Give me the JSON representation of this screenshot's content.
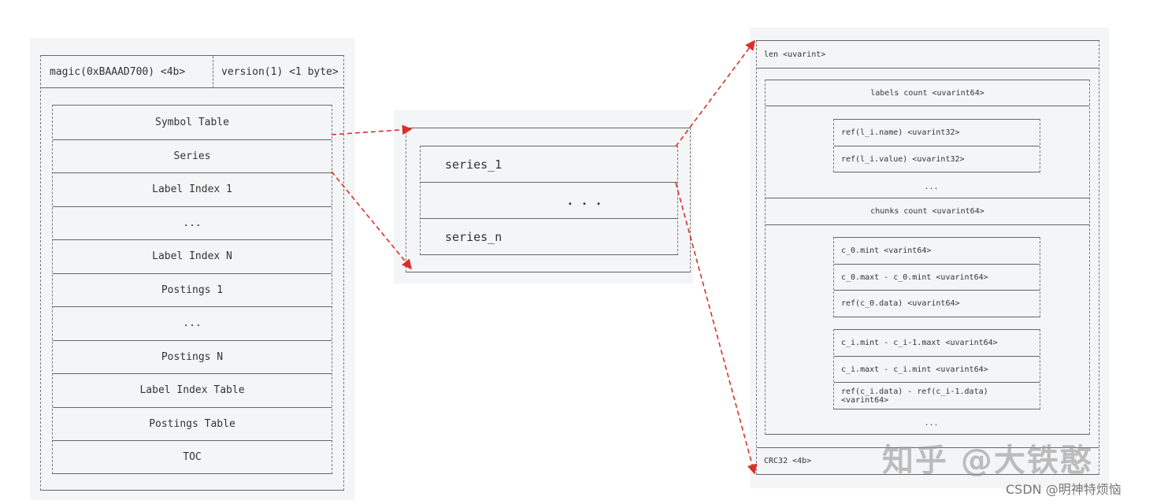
{
  "index_format": {
    "magic": "magic(0xBAAAD700) <4b>",
    "version": "version(1) <1 byte>",
    "sections": [
      "Symbol Table",
      "Series",
      "Label Index 1",
      "...",
      "Label Index N",
      "Postings 1",
      "...",
      "Postings N",
      "Label Index Table",
      "Postings Table",
      "TOC"
    ]
  },
  "series_list": {
    "items": [
      "series_1",
      ". . .",
      "series_n"
    ]
  },
  "series_entry": {
    "len": "len <uvarint>",
    "labels_count": "labels count <uvarint64>",
    "label_refs": [
      "ref(l_i.name) <uvarint32>",
      "ref(l_i.value) <uvarint32>"
    ],
    "labels_ellipsis": "...",
    "chunks_count": "chunks count <uvarint64>",
    "chunk_0": [
      "c_0.mint <varint64>",
      "c_0.maxt - c_0.mint <uvarint64>",
      "ref(c_0.data) <uvarint64>"
    ],
    "chunk_i": [
      "c_i.mint - c_i-1.maxt <uvarint64>",
      "c_i.maxt - c_i.mint <uvarint64>",
      "ref(c_i.data) - ref(c_i-1.data) <varint64>"
    ],
    "chunks_ellipsis": "...",
    "crc": "CRC32 <4b>"
  },
  "colors": {
    "arrow": "#d9302c",
    "border": "#666666",
    "panel": "#f4f5f6"
  },
  "watermarks": {
    "zhihu": "知乎 @大铁憨",
    "csdn": "CSDN @明神特烦恼"
  }
}
